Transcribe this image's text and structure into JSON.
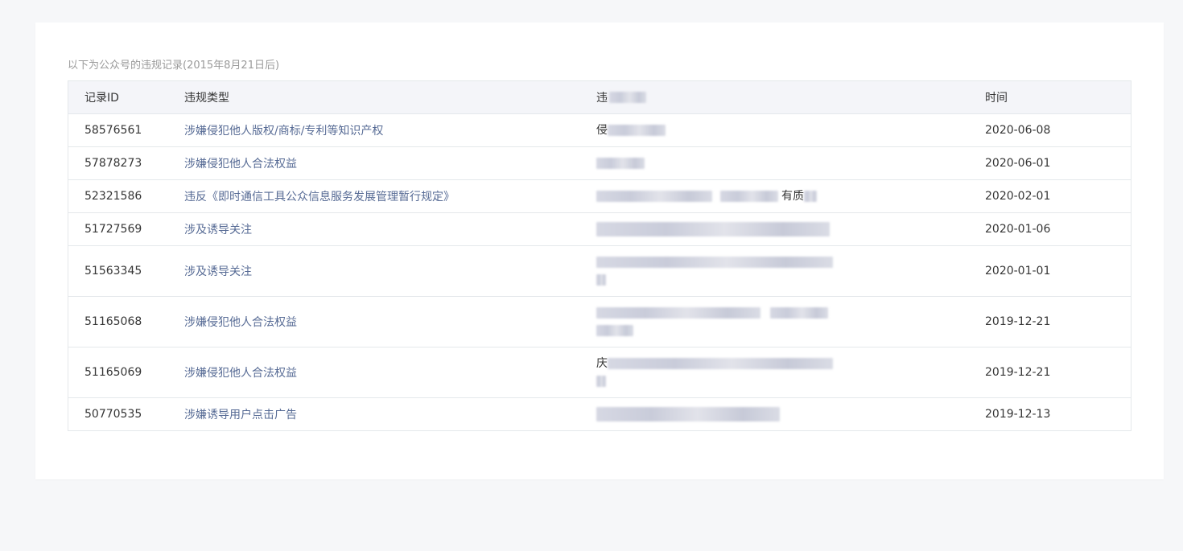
{
  "caption": "以下为公众号的违规记录(2015年8月21日后)",
  "table": {
    "headers": {
      "id": "记录ID",
      "type": "违规类型",
      "content": "违",
      "time": "时间"
    },
    "rows": [
      {
        "id": "58576561",
        "type": "涉嫌侵犯他人版权/商标/专利等知识产权",
        "content_visible": "侵",
        "time": "2020-06-08"
      },
      {
        "id": "57878273",
        "type": "涉嫌侵犯他人合法权益",
        "content_visible": "",
        "time": "2020-06-01"
      },
      {
        "id": "52321586",
        "type": "违反《即时通信工具公众信息服务发展管理暂行规定》",
        "content_visible": "有质",
        "time": "2020-02-01"
      },
      {
        "id": "51727569",
        "type": "涉及诱导关注",
        "content_visible": "",
        "time": "2020-01-06"
      },
      {
        "id": "51563345",
        "type": "涉及诱导关注",
        "content_visible": "",
        "time": "2020-01-01"
      },
      {
        "id": "51165068",
        "type": "涉嫌侵犯他人合法权益",
        "content_visible": "",
        "time": "2019-12-21"
      },
      {
        "id": "51165069",
        "type": "涉嫌侵犯他人合法权益",
        "content_visible": "庆",
        "time": "2019-12-21"
      },
      {
        "id": "50770535",
        "type": "涉嫌诱导用户点击广告",
        "content_visible": "",
        "time": "2019-12-13"
      }
    ]
  }
}
